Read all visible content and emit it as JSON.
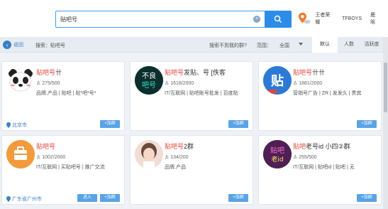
{
  "search": {
    "value": "贴吧号"
  },
  "top_links": [
    "王者荣耀",
    "TFBOYS",
    "鹿晗"
  ],
  "subbar": {
    "back_label": "返回",
    "search_label": "搜索：贴吧号",
    "no_find": "搜索不到我的群?",
    "range_label": "范围：",
    "range_value": "全国",
    "tabs": [
      "默认",
      "人数",
      "活跃度"
    ]
  },
  "cards": [
    {
      "name_hl": "贴吧号",
      "name_rest": "卄",
      "count": "275/500",
      "tags": "品牌.产品 | 贴吧 | 贴*吧*号*",
      "location": "北京市",
      "add_label": "+加群"
    },
    {
      "name_hl": "贴吧号",
      "name_rest": "发贴、号 [佚客",
      "count": "1618/2000",
      "tags": "IT/互联网 | 贴吧账号批发 | 百度贴",
      "location": "",
      "add_label": "+加群"
    },
    {
      "name_hl": "贴吧号",
      "name_rest": "卄卄",
      "count": "1881/2000",
      "tags": "营销号广告 | ZR | 发发久 | 贵宾",
      "location": "",
      "add_label": "+加群"
    },
    {
      "name_hl": "贴吧号",
      "name_rest": "",
      "count": "1002/2000",
      "tags": "IT/互联网 | 买贴吧号 | 推广交流",
      "location": "广东省广州市",
      "enter_label": "进入",
      "add_label": "+加群"
    },
    {
      "name_hl": "贴吧号",
      "name_rest": "2群",
      "count": "134/200",
      "tags": "品牌.产品",
      "location": "",
      "add_label": "+加群"
    },
    {
      "name_hl": "贴吧",
      "name_rest": "老号id 小四②群",
      "count": "255/500",
      "tags": "IT/互联网 | 贴吧id | 贴吧 | 无",
      "location": "",
      "add_label": "+加群"
    }
  ],
  "icons": [
    "search-icon",
    "location-pin-icon",
    "back-arrow-icon",
    "panda-avatar",
    "dark-logo-avatar",
    "tie-logo-avatar",
    "briefcase-avatar",
    "girl-photo-avatar",
    "tieba-id-avatar"
  ]
}
